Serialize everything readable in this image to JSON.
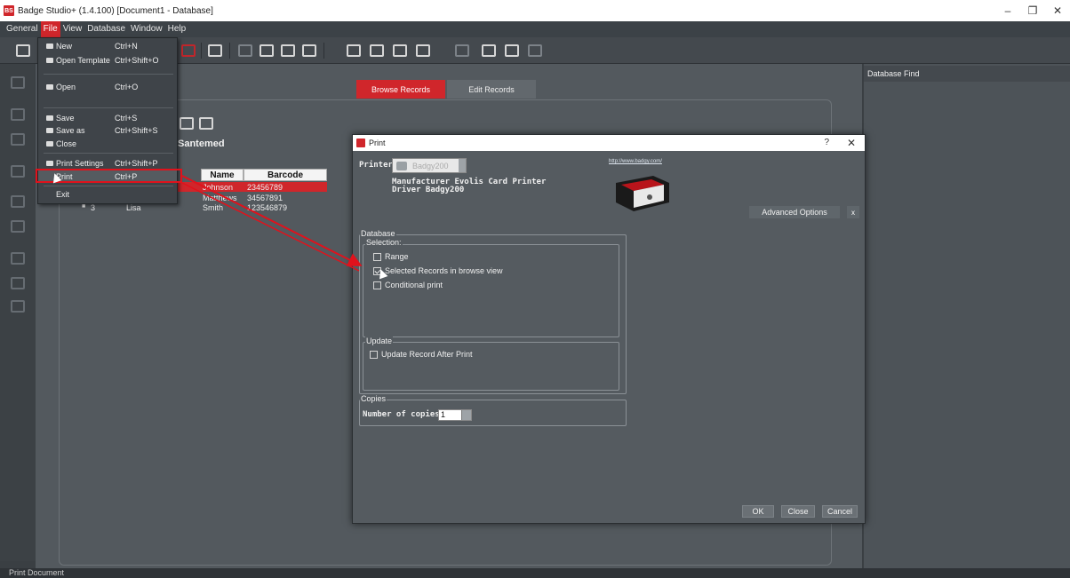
{
  "window": {
    "title": "Badge Studio+ (1.4.100) [Document1 - Database]",
    "logo_text": "BS",
    "controls": [
      "–",
      "❐",
      "✕"
    ]
  },
  "menubar": [
    "General",
    "File",
    "View",
    "Database",
    "Window",
    "Help"
  ],
  "file_menu": [
    {
      "label": "New",
      "shortcut": "Ctrl+N",
      "icon": "new-icon"
    },
    {
      "label": "Open Template",
      "shortcut": "Ctrl+Shift+O",
      "icon": "open-template-icon"
    },
    {
      "label": "Open",
      "shortcut": "Ctrl+O",
      "icon": "open-icon"
    },
    {
      "label": "Save",
      "shortcut": "Ctrl+S",
      "icon": "save-icon"
    },
    {
      "label": "Save as",
      "shortcut": "Ctrl+Shift+S",
      "icon": "save-as-icon"
    },
    {
      "label": "Close",
      "shortcut": "",
      "icon": "close-doc-icon"
    },
    {
      "label": "Print Settings",
      "shortcut": "Ctrl+Shift+P",
      "icon": "print-settings-icon"
    },
    {
      "label": "Print",
      "shortcut": "Ctrl+P",
      "icon": "print-icon"
    },
    {
      "label": "Exit",
      "shortcut": "",
      "icon": ""
    }
  ],
  "tabs": {
    "browse": "Browse Records",
    "edit": "Edit Records"
  },
  "right_panel": {
    "title": "Database Find"
  },
  "database": {
    "title_suffix": "Santemed",
    "columns": [
      "Name",
      "Barcode"
    ],
    "rows": [
      {
        "first": "",
        "name": "Johnson",
        "barcode": "23456789",
        "selected": true
      },
      {
        "first": "",
        "name": "Matthews",
        "barcode": "34567891",
        "selected": false
      },
      {
        "index": "3",
        "first": "Lisa",
        "name": "Smith",
        "barcode": "123546879",
        "selected": false
      }
    ]
  },
  "status": "Print Document",
  "print_dialog": {
    "title": "Print",
    "help": "?",
    "close": "✕",
    "printer_label": "Printer",
    "printer_value": "Badgy200",
    "manufacturer": "Manufacturer Evolis Card Printer",
    "driver": "Driver Badgy200",
    "link": "http://www.badgy.com/",
    "advanced_options": "Advanced Options",
    "advanced_close": "x",
    "database_group": "Database",
    "selection_group": "Selection:",
    "options": [
      {
        "label": "Range",
        "checked": false
      },
      {
        "label": "Selected Records in browse view",
        "checked": true
      },
      {
        "label": "Conditional print",
        "checked": false
      }
    ],
    "update_group": "Update",
    "update_option": {
      "label": "Update Record After Print",
      "checked": false
    },
    "copies_group": "Copies",
    "copies_label": "Number of copies",
    "copies_value": "1",
    "buttons": {
      "ok": "OK",
      "close": "Close",
      "cancel": "Cancel"
    }
  },
  "colors": {
    "accent": "#d0262b",
    "highlight_box": "#e0121c"
  }
}
